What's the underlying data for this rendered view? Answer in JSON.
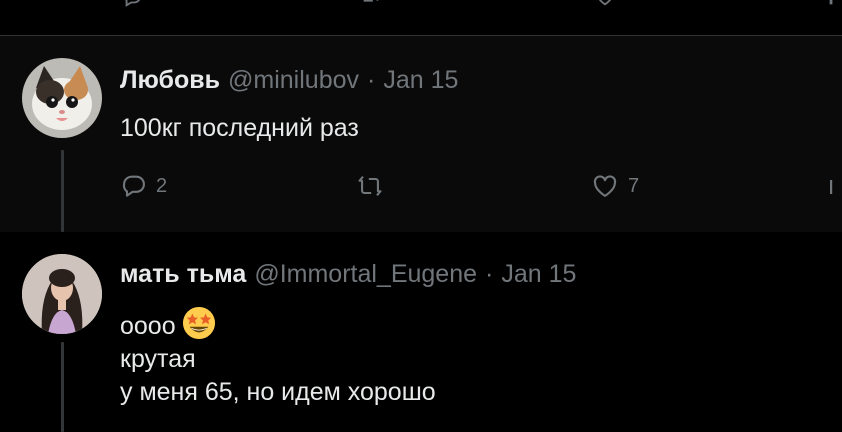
{
  "tweets": [
    {
      "name": "Любовь",
      "handle": "@minilubov",
      "separator": "·",
      "date": "Jan 15",
      "text_lines": [
        "100кг последний раз"
      ],
      "actions": {
        "reply_count": "2",
        "retweet_count": "",
        "like_count": "7"
      }
    },
    {
      "name": "мать тьма",
      "handle": "@Immortal_Eugene",
      "separator": "·",
      "date": "Jan 15",
      "text_lines": [
        "оооо",
        "крутая",
        "у меня 65, но идем хорошо"
      ],
      "emoji": "star-struck-emoji"
    }
  ],
  "icons": {
    "reply": "reply-icon",
    "retweet": "retweet-icon",
    "like": "heart-icon",
    "views": "views-icon"
  },
  "colors": {
    "background": "#000000",
    "tweet_highlight_bg": "#0a0a0a",
    "text_primary": "#e7e9ea",
    "text_secondary": "#71767b",
    "divider": "#2f3336"
  }
}
